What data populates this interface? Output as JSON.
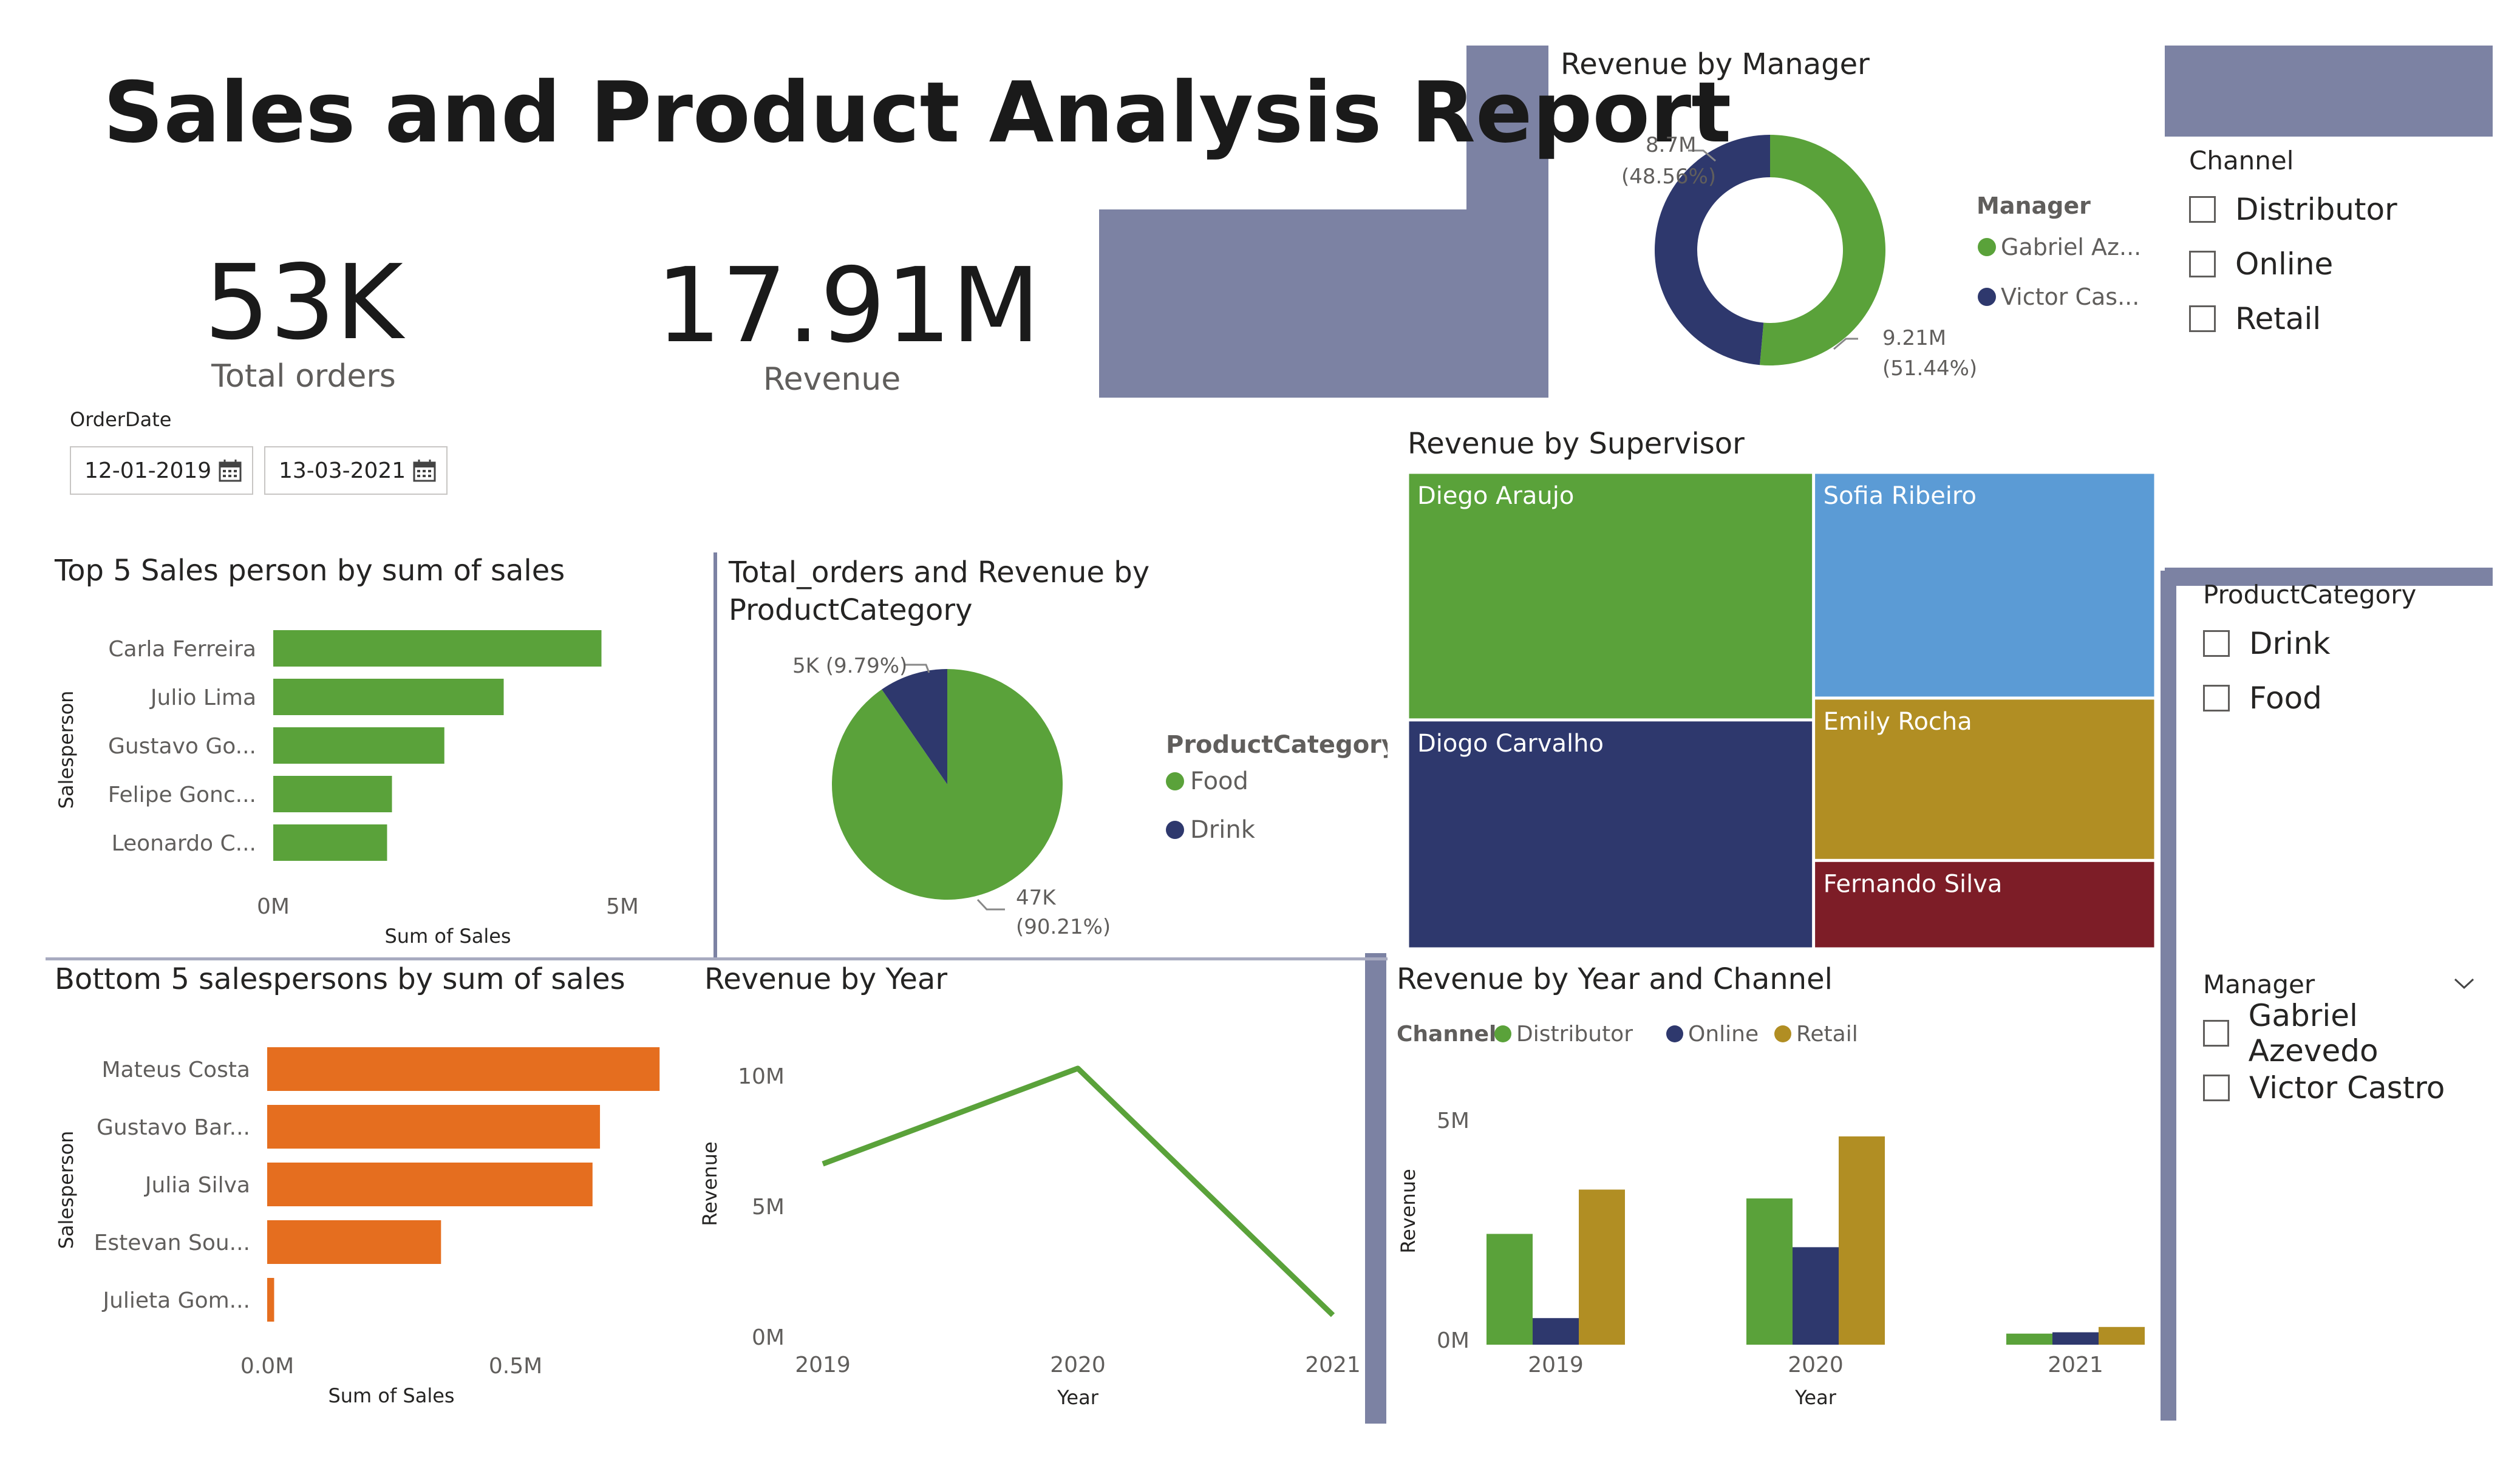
{
  "report_title": "Sales and Product Analysis Report",
  "kpis": {
    "orders_value": "53K",
    "orders_label": "Total orders",
    "revenue_value": "17.91M",
    "revenue_label": "Revenue"
  },
  "order_date": {
    "label": "OrderDate",
    "start": "12-01-2019",
    "end": "13-03-2021"
  },
  "slicers": {
    "channel": {
      "title": "Channel",
      "options": [
        "Distributor",
        "Online",
        "Retail"
      ]
    },
    "product_category": {
      "title": "ProductCategory",
      "options": [
        "Drink",
        "Food"
      ]
    },
    "manager": {
      "title": "Manager",
      "options": [
        "Gabriel Azevedo",
        "Victor Castro"
      ]
    }
  },
  "colors": {
    "green": "#5aa23a",
    "navy": "#2e386d",
    "gold": "#b18e23",
    "orange": "#e56e1f",
    "blue": "#5b9bd5",
    "maroon": "#7d1d27",
    "deco": "#7c82a3"
  },
  "chart_data": [
    {
      "id": "top5",
      "type": "bar",
      "orientation": "horizontal",
      "title": "Top 5 Sales person by sum of sales",
      "xlabel": "Sum of Sales",
      "ylabel": "Salesperson",
      "categories": [
        "Carla Ferreira",
        "Julio Lima",
        "Gustavo Go...",
        "Felipe Gonc...",
        "Leonardo C..."
      ],
      "values": [
        4700000,
        3300000,
        2450000,
        1700000,
        1630000
      ],
      "xlim": [
        0,
        5000000
      ],
      "x_ticks": [
        "0M",
        "5M"
      ],
      "color": "#5aa23a"
    },
    {
      "id": "bottom5",
      "type": "bar",
      "orientation": "horizontal",
      "title": "Bottom 5 salespersons by sum of sales",
      "xlabel": "Sum of Sales",
      "ylabel": "Salesperson",
      "categories": [
        "Mateus Costa",
        "Gustavo Bar...",
        "Julia Silva",
        "Estevan Sou...",
        "Julieta Gom..."
      ],
      "values": [
        790000,
        670000,
        655000,
        350000,
        14000
      ],
      "xlim": [
        0,
        500000
      ],
      "x_ticks": [
        "0.0M",
        "0.5M"
      ],
      "color": "#e56e1f"
    },
    {
      "id": "category_pie",
      "type": "pie",
      "title": "Total_orders and Revenue by ProductCategory",
      "legend_title": "ProductCategory",
      "slices": [
        {
          "name": "Food",
          "value": 47000,
          "label": "47K",
          "pct": "(90.21%)",
          "color": "#5aa23a"
        },
        {
          "name": "Drink",
          "value": 5000,
          "label": "5K (9.79%)",
          "pct": "",
          "color": "#2e386d"
        }
      ]
    },
    {
      "id": "manager_donut",
      "type": "pie",
      "title": "Revenue by Manager",
      "legend_title": "Manager",
      "slices": [
        {
          "name": "Gabriel Az...",
          "value": 9.21,
          "label": "9.21M",
          "pct": "(51.44%)",
          "color": "#5aa23a"
        },
        {
          "name": "Victor Cas...",
          "value": 8.7,
          "label": "8.7M",
          "pct": "(48.56%)",
          "color": "#2e386d"
        }
      ]
    },
    {
      "id": "supervisor_treemap",
      "type": "treemap",
      "title": "Revenue by Supervisor",
      "items": [
        {
          "name": "Diego Araujo",
          "value": 5.05,
          "color": "#5aa23a"
        },
        {
          "name": "Diogo Carvalho",
          "value": 4.67,
          "color": "#2e386d"
        },
        {
          "name": "Sofia Ribeiro",
          "value": 3.88,
          "color": "#5b9bd5"
        },
        {
          "name": "Emily Rocha",
          "value": 2.79,
          "color": "#b18e23"
        },
        {
          "name": "Fernando Silva",
          "value": 1.52,
          "color": "#7d1d27"
        }
      ]
    },
    {
      "id": "revenue_year",
      "type": "line",
      "title": "Revenue by Year",
      "xlabel": "Year",
      "ylabel": "Revenue",
      "x": [
        "2019",
        "2020",
        "2021"
      ],
      "values": [
        6700000,
        10300000,
        1000000
      ],
      "ylim": [
        0,
        10000000
      ],
      "y_ticks": [
        "0M",
        "5M",
        "10M"
      ],
      "color": "#5aa23a"
    },
    {
      "id": "revenue_year_channel",
      "type": "bar",
      "title": "Revenue by Year and Channel",
      "xlabel": "Year",
      "ylabel": "Revenue",
      "legend_title": "Channel",
      "categories": [
        "2019",
        "2020",
        "2021"
      ],
      "series": [
        {
          "name": "Distributor",
          "values": [
            2500000,
            3300000,
            250000
          ],
          "color": "#5aa23a"
        },
        {
          "name": "Online",
          "values": [
            600000,
            2200000,
            280000
          ],
          "color": "#2e386d"
        },
        {
          "name": "Retail",
          "values": [
            3500000,
            4700000,
            400000
          ],
          "color": "#b18e23"
        }
      ],
      "ylim": [
        0,
        5000000
      ],
      "y_ticks": [
        "0M",
        "5M"
      ]
    }
  ]
}
